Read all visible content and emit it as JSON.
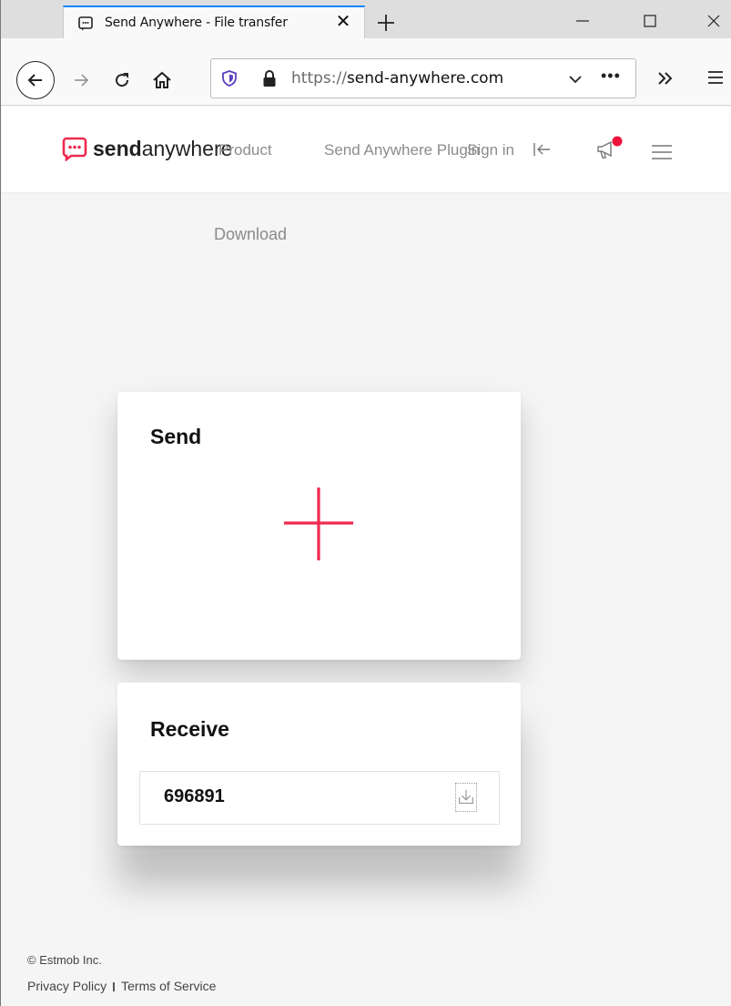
{
  "browser": {
    "tab": {
      "title": "Send Anywhere - File transfer",
      "close_glyph": "✕"
    },
    "url": {
      "protocol": "https://",
      "host": "send-anywhere.com",
      "more_glyph": "•••"
    },
    "icons": [
      "favicon-icon",
      "close-icon",
      "new-tab-icon",
      "minimize-icon",
      "maximize-icon",
      "window-close-icon",
      "back-icon",
      "forward-icon",
      "reload-icon",
      "home-icon",
      "shield-icon",
      "lock-icon",
      "chevron-down-icon",
      "more-icon",
      "overflow-icon",
      "hamburger-icon"
    ]
  },
  "header": {
    "logo_bold": "send",
    "logo_light": "anywhere",
    "nav": {
      "product": "Product",
      "plugin": "Send Anywhere Plugin",
      "signin": "Sign in"
    },
    "icons": [
      "collapse-icon",
      "megaphone-icon",
      "menu-icon"
    ]
  },
  "download_link": "Download",
  "send": {
    "title": "Send"
  },
  "receive": {
    "title": "Receive",
    "key_value": "696891"
  },
  "footer": {
    "copyright": "© Estmob Inc.",
    "privacy": "Privacy Policy",
    "terms": "Terms of Service"
  },
  "colors": {
    "brand": "#ee2a4f",
    "browser_accent": "#0a84ff",
    "notification_dot": "#f0143c"
  }
}
